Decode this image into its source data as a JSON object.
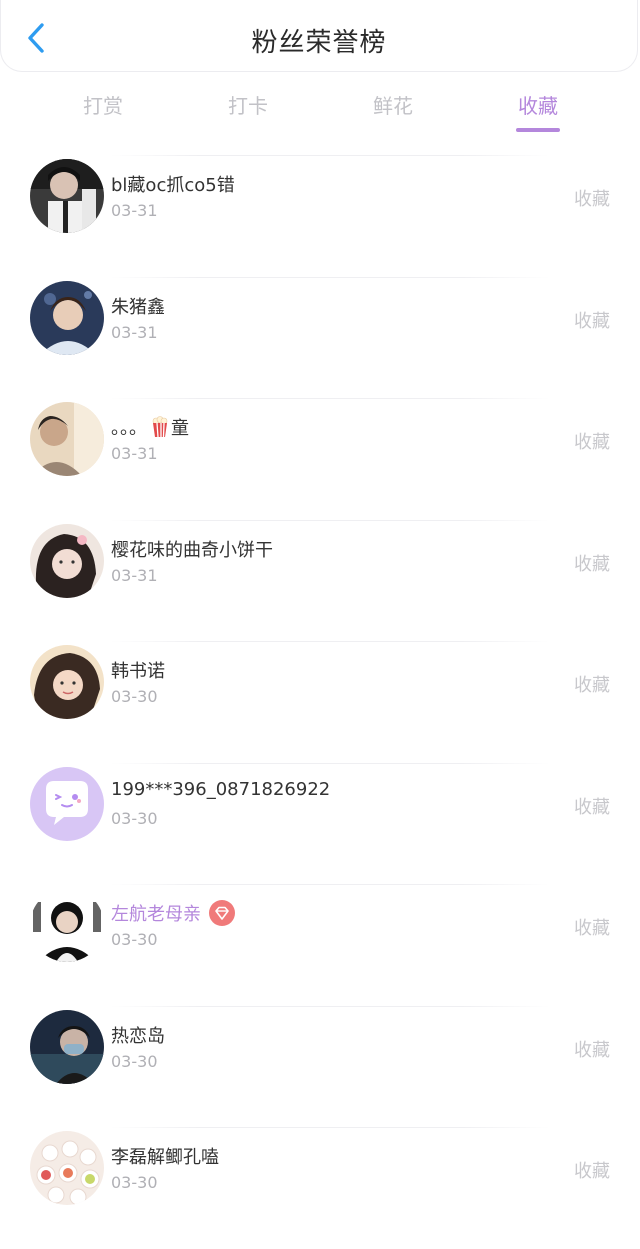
{
  "header": {
    "title": "粉丝荣誉榜",
    "back_icon": "chevron-left-icon"
  },
  "tabs": [
    {
      "label": "打赏",
      "active": false
    },
    {
      "label": "打卡",
      "active": false
    },
    {
      "label": "鲜花",
      "active": false
    },
    {
      "label": "收藏",
      "active": true
    }
  ],
  "colors": {
    "accent": "#b487dc",
    "back": "#2e9cf0",
    "badge": "#f07a7a"
  },
  "list": [
    {
      "name": "bl藏oc抓co5错",
      "date": "03-31",
      "action": "收藏"
    },
    {
      "name": "朱猪鑫",
      "date": "03-31",
      "action": "收藏"
    },
    {
      "name_prefix": "。。。",
      "name_emoji": "popcorn-icon",
      "name_suffix": "童",
      "date": "03-31",
      "action": "收藏"
    },
    {
      "name": "樱花味的曲奇小饼干",
      "date": "03-31",
      "action": "收藏"
    },
    {
      "name": "韩书诺",
      "date": "03-30",
      "action": "收藏"
    },
    {
      "name": "199***396_0871826922",
      "date": "03-30",
      "action": "收藏"
    },
    {
      "name": "左航老母亲",
      "badge": "diamond-badge-icon",
      "date": "03-30",
      "action": "收藏"
    },
    {
      "name": "热恋岛",
      "date": "03-30",
      "action": "收藏"
    },
    {
      "name": "李磊解鲫孔嗑",
      "date": "03-30",
      "action": "收藏"
    }
  ]
}
